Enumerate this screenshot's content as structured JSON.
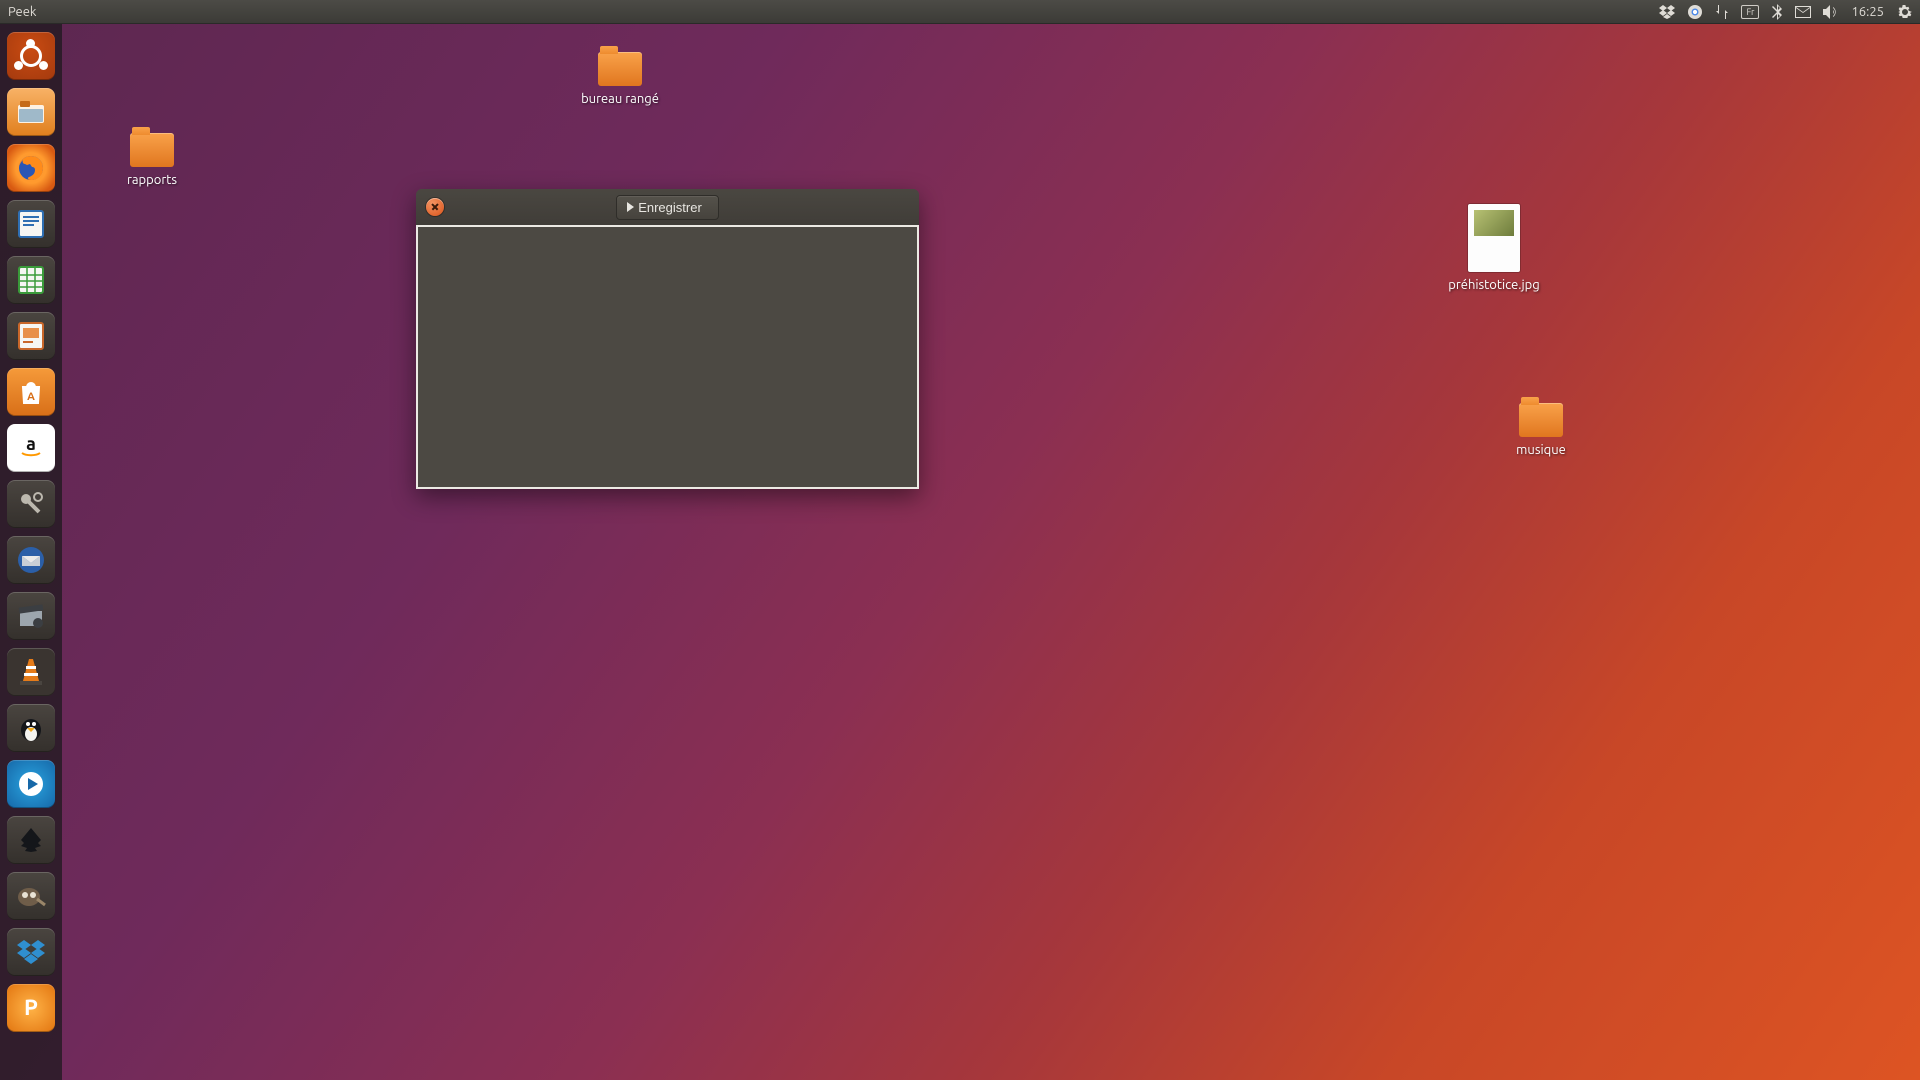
{
  "menubar": {
    "app_title": "Peek",
    "keyboard_layout": "Fr",
    "time": "16:25"
  },
  "desktop": {
    "icons": {
      "bureau_range": {
        "label": "bureau rangé"
      },
      "rapports": {
        "label": "rapports"
      },
      "prehistotice": {
        "label": "préhistotice.jpg"
      },
      "musique": {
        "label": "musique"
      }
    }
  },
  "peek_window": {
    "record_button_label": "Enregistrer"
  }
}
